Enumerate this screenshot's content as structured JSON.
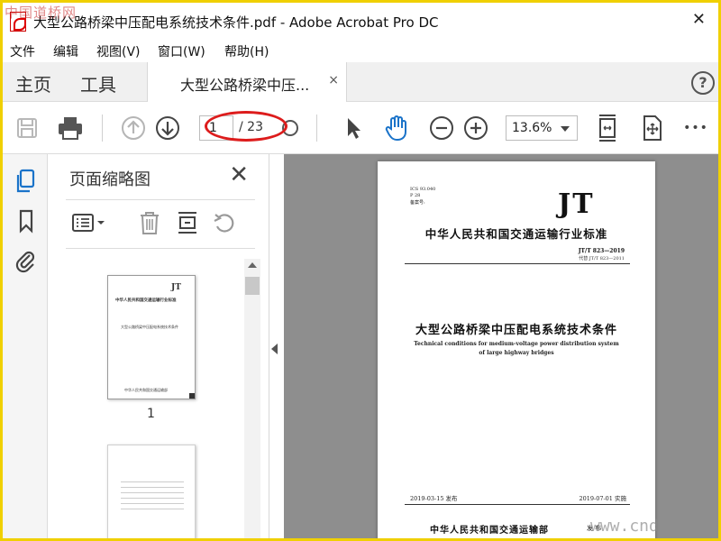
{
  "window": {
    "title": "大型公路桥梁中压配电系统技术条件.pdf - Adobe Acrobat Pro DC",
    "close_glyph": "✕",
    "watermark_top": "中国道桥网",
    "watermark_bottom": "www.cnd"
  },
  "menu": {
    "items": [
      {
        "label": "文件"
      },
      {
        "label": "编辑"
      },
      {
        "label": "视图(V)"
      },
      {
        "label": "窗口(W)"
      },
      {
        "label": "帮助(H)"
      }
    ]
  },
  "tabs": {
    "home": "主页",
    "tools": "工具",
    "document": "大型公路桥梁中压...",
    "document_close": "×",
    "help": "?"
  },
  "toolbar": {
    "current_page": "1",
    "total_pages": "/ 23",
    "zoom": "13.6%",
    "more": "•••"
  },
  "thumbnails": {
    "title": "页面缩略图",
    "close": "✕",
    "pages": [
      {
        "number": "1"
      },
      {
        "number": ""
      }
    ],
    "thumb1": {
      "logo": "JT",
      "title": "中华人民共和国交通运输行业标准",
      "cn_title": "大型公路桥梁中压配电系统技术条件",
      "publisher": "中华人民共和国交通运输部"
    }
  },
  "document": {
    "ics": "ICS 93.040",
    "p_code": "P 28",
    "filing": "备案号:",
    "logo": "JT",
    "standard_title": "中华人民共和国交通运输行业标准",
    "standard_number": "JT/T 823—2019",
    "replaces": "代替 JT/T 823—2011",
    "title_cn": "大型公路桥梁中压配电系统技术条件",
    "title_en": "Technical conditions for medium-voltage power distribution system of large highway bridges",
    "issue_date": "2019-03-15 发布",
    "effective_date": "2019-07-01 实施",
    "publisher": "中华人民共和国交通运输部",
    "publisher_suffix": "发 布"
  },
  "colors": {
    "accent_blue": "#1a73c9",
    "annotation_red": "#dd1c1c",
    "frame_yellow": "#f0d000"
  }
}
